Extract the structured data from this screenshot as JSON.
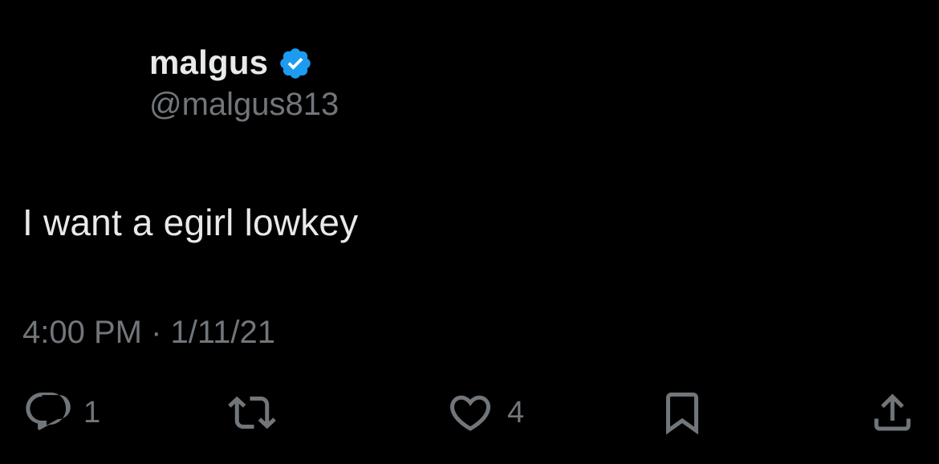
{
  "author": {
    "display_name": "malgus",
    "handle": "@malgus813",
    "verified_icon": "verified-badge-icon",
    "verified_color": "#1d9bf0"
  },
  "tweet": {
    "text": "I want a egirl lowkey",
    "time": "4:00 PM · 1/11/21"
  },
  "actions": {
    "reply_count": "1",
    "retweet_count": "",
    "like_count": "4"
  },
  "colors": {
    "background": "#000000",
    "primary_text": "#e7e9ea",
    "secondary_text": "#71767b"
  }
}
